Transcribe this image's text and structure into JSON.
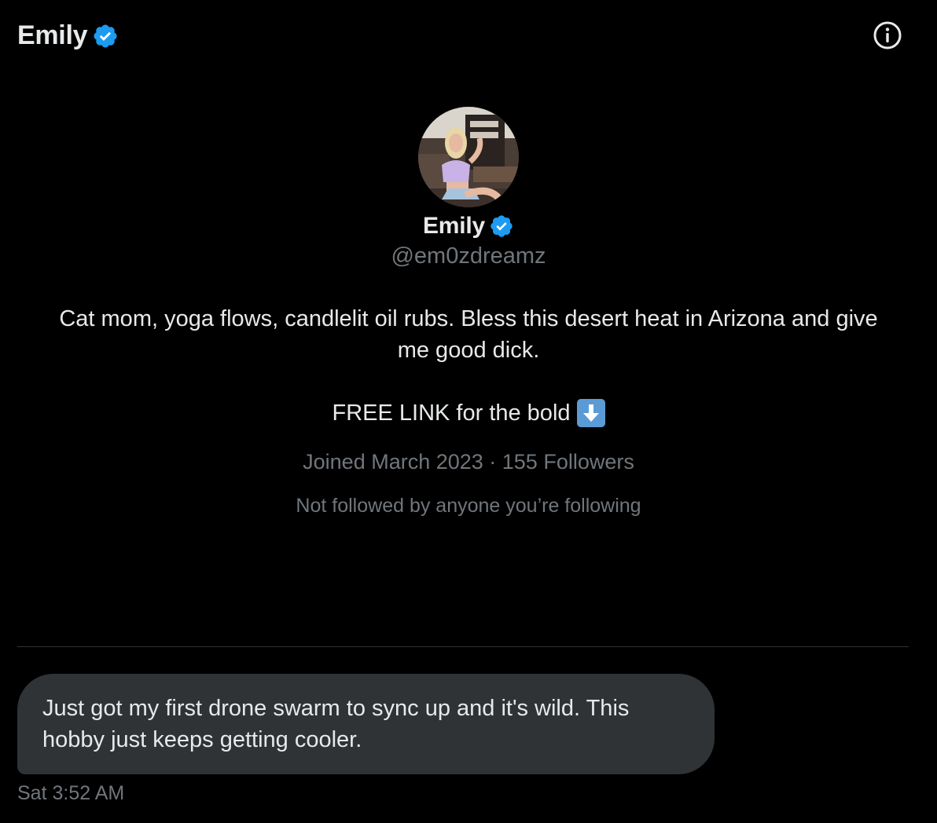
{
  "header": {
    "title": "Emily",
    "verified_icon": "verified-badge-icon",
    "info_icon": "info-icon"
  },
  "profile": {
    "avatar_icon": "profile-photo",
    "display_name": "Emily",
    "handle": "@em0zdreamz",
    "bio_line1": "Cat mom, yoga flows, candlelit oil rubs. Bless this desert heat in Arizona and give me good dick.",
    "bio_line2": "FREE LINK for the bold",
    "bio_emoji": "down-arrow-emoji",
    "meta": "Joined March 2023 · 155 Followers",
    "followers_context": "Not followed by anyone you’re following"
  },
  "conversation": {
    "messages": [
      {
        "text": "Just got my first drone swarm to sync up and it's wild. This hobby just keeps getting cooler.",
        "timestamp": "Sat 3:52 AM"
      }
    ]
  },
  "colors": {
    "background": "#000000",
    "primary_text": "#e7e9ea",
    "secondary_text": "#71767b",
    "verified_blue": "#1d9bf0",
    "bubble": "#2f3336",
    "divider": "#2f3336"
  }
}
